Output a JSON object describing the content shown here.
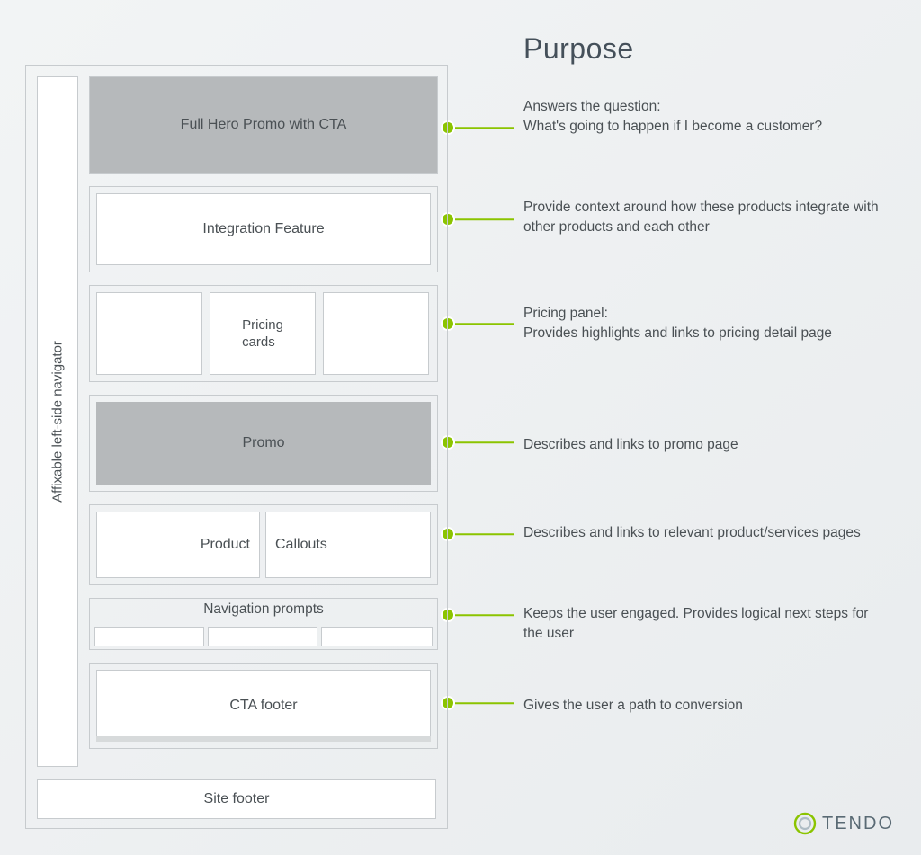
{
  "heading": "Purpose",
  "rail_label": "Affixable left-side navigator",
  "blocks": {
    "hero": "Full Hero Promo with CTA",
    "integration": "Integration Feature",
    "pricing": "Pricing\ncards",
    "promo": "Promo",
    "product_l": "Product",
    "product_r": "Callouts",
    "nav": "Navigation prompts",
    "cta": "CTA footer",
    "site_footer": "Site footer"
  },
  "descriptions": {
    "hero": "Answers the question:\nWhat's going to happen if I become a customer?",
    "integration": "Provide context around how these products integrate with other products and each other",
    "pricing": "Pricing panel:\nProvides highlights and links to pricing detail page",
    "promo": "Describes and links to promo page",
    "product": "Describes and links to relevant product/services pages",
    "nav": "Keeps the user engaged. Provides logical next steps for the user",
    "cta": "Gives the user a path to conversion"
  },
  "brand": "TENDO",
  "accent_color": "#8bc400"
}
